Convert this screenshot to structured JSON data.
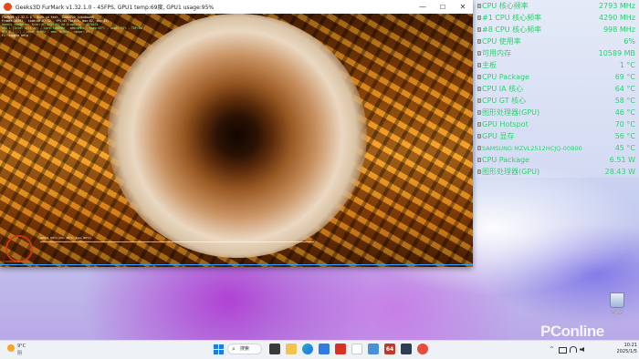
{
  "furmark": {
    "title": "Geeks3D FurMark v1.32.1.0 - 45FPS, GPU1 temp:69度, GPU1 usage:95%",
    "window_controls": {
      "minimize": "—",
      "maximize": "☐",
      "close": "✕"
    },
    "overlay_lines": [
      "FurMark v1.32.1.0 - Burn-in test, 1280x720 (windowed)",
      "Frames:20391 - time:00:07:32 - FPS:45 (min:3, max:62, avg:45)",
      "OpenGL renderer: Intel(R) Iris(R) Xe Graphics - 4870x7x",
      "GPU 1 (Intel Iris Xe) - core:1300MHz - mem:0MHz - temp:69°C - power:95% - TDP:0W",
      "GPU 2 (...) - core: 0 MHz - mem: 0 MHz - usage: 0%",
      "F1: toggle help"
    ],
    "graph_label": "GPU 1: 69°C (min: 44°C - max: 69°C)",
    "logo_text": "FURMARK BURN-IN"
  },
  "sensor_panel": {
    "rows": [
      {
        "label": "CPU 核心频率",
        "value": "2793 MHz"
      },
      {
        "label": "#1 CPU 核心频率",
        "value": "4290 MHz"
      },
      {
        "label": "#8 CPU 核心频率",
        "value": "998 MHz"
      },
      {
        "label": "CPU 使用率",
        "value": "6%"
      },
      {
        "label": "可用内存",
        "value": "10589 MB"
      },
      {
        "label": "主板",
        "value": "1 °C"
      },
      {
        "label": "CPU Package",
        "value": "69 °C"
      },
      {
        "label": "CPU IA 核心",
        "value": "64 °C"
      },
      {
        "label": "CPU GT 核心",
        "value": "58 °C"
      },
      {
        "label": "图形处理器(GPU)",
        "value": "46 °C"
      },
      {
        "label": "GPU Hotspot",
        "value": "70 °C"
      },
      {
        "label": "GPU 显存",
        "value": "56 °C"
      },
      {
        "label": "SAMSUNG MZVL2512HCJQ-00B00",
        "value": "45 °C"
      },
      {
        "label": "CPU Package",
        "value": "6.51 W"
      },
      {
        "label": "图形处理器(GPU)",
        "value": "28.43 W"
      }
    ],
    "color": "#1fcc6b"
  },
  "desktop": {
    "recycle_bin_label": "回收站"
  },
  "watermark": "PConline",
  "taskbar": {
    "weather_temp": "9°C",
    "weather_desc": "阴",
    "search_label": "搜索",
    "search_glyph": "⌕",
    "app_64_label": "64",
    "tray_chevron": "^",
    "time": "10:21",
    "date": "2025/1/5"
  }
}
